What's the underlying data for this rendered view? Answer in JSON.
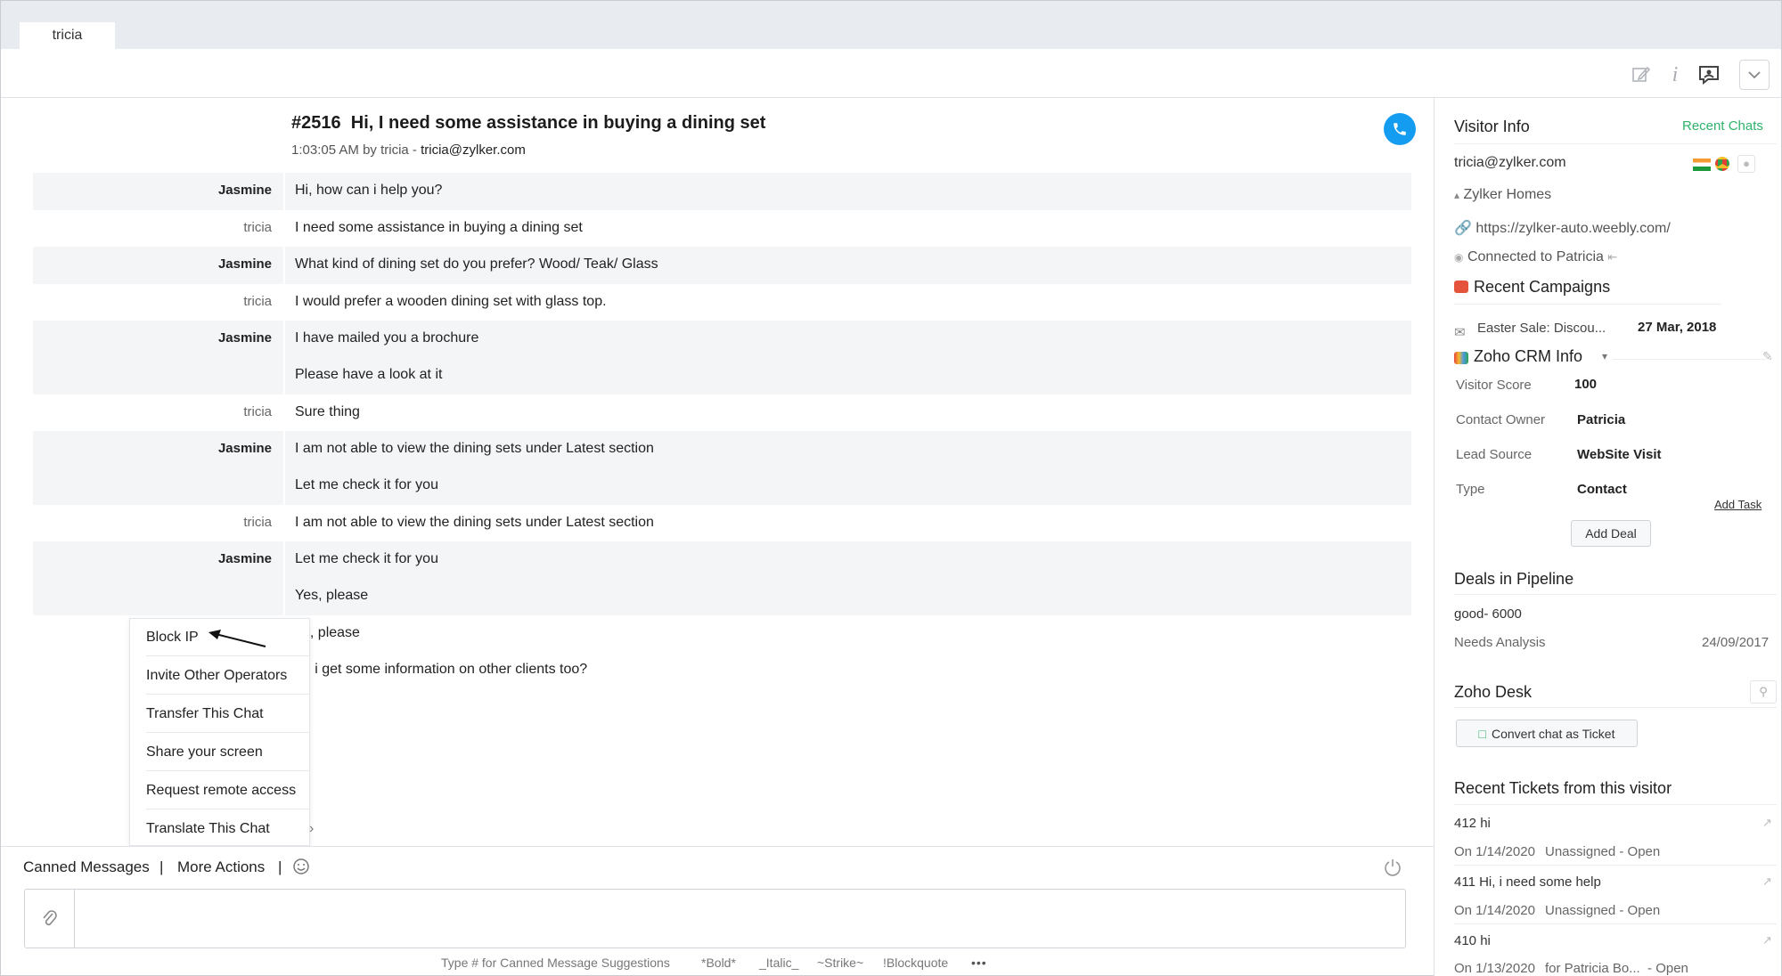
{
  "tabs": [
    "tricia"
  ],
  "chat": {
    "id": "#2516",
    "subject": "Hi, I need some assistance in buying a dining set",
    "time": "1:03:05 AM",
    "by_prefix": "by",
    "visitor": "tricia",
    "dash": "-",
    "email": "tricia@zylker.com"
  },
  "messages": [
    {
      "name": "Jasmine",
      "role": "operator",
      "lines": [
        "Hi, how can i help you?"
      ]
    },
    {
      "name": "tricia",
      "role": "visitor",
      "lines": [
        "I need some assistance in buying a dining set"
      ]
    },
    {
      "name": "Jasmine",
      "role": "operator",
      "lines": [
        "What kind of dining set do you prefer? Wood/ Teak/ Glass"
      ]
    },
    {
      "name": "tricia",
      "role": "visitor",
      "lines": [
        "I would prefer a wooden dining set with glass top."
      ]
    },
    {
      "name": "Jasmine",
      "role": "operator",
      "lines": [
        "I have mailed you a brochure",
        "Please have a look at it"
      ]
    },
    {
      "name": "tricia",
      "role": "visitor",
      "lines": [
        "Sure thing"
      ]
    },
    {
      "name": "Jasmine",
      "role": "operator",
      "lines": [
        "I am not able to view the dining sets under Latest section",
        "Let me check it for you"
      ]
    },
    {
      "name": "tricia",
      "role": "visitor",
      "lines": [
        "I am not able to view the dining sets under Latest section"
      ]
    },
    {
      "name": "Jasmine",
      "role": "operator",
      "lines": [
        "Let me check it for you",
        "Yes, please"
      ]
    },
    {
      "name": "",
      "role": "visitor",
      "lines": [
        "es, please"
      ]
    },
    {
      "name": "",
      "role": "visitor",
      "lines": [
        "an i get some information on other clients too?"
      ]
    }
  ],
  "more_actions_menu": [
    "Block IP",
    "Invite Other Operators",
    "Transfer This Chat",
    "Share your screen",
    "Request remote access",
    "Translate This Chat"
  ],
  "bottom_bar": {
    "canned": "Canned Messages",
    "sep": "|",
    "more_actions": "More Actions",
    "hints": [
      "Type # for Canned Message Suggestions",
      "*Bold*",
      "_Italic_",
      "~Strike~",
      "!Blockquote",
      "•••"
    ]
  },
  "visitor_info": {
    "title": "Visitor Info",
    "recent_chats": "Recent Chats",
    "email": "tricia@zylker.com",
    "company": "Zylker Homes",
    "url": "https://zylker-auto.weebly.com/",
    "connected": "Connected to Patricia"
  },
  "recent_campaigns": {
    "title": "Recent Campaigns",
    "name": "Easter Sale: Discou...",
    "date": "27 Mar, 2018"
  },
  "crm": {
    "title": "Zoho CRM Info",
    "fields": [
      {
        "label": "Visitor Score",
        "value": "100"
      },
      {
        "label": "Contact Owner",
        "value": "Patricia"
      },
      {
        "label": "Lead Source",
        "value": "WebSite Visit"
      },
      {
        "label": "Type",
        "value": "Contact"
      }
    ],
    "add_task": "Add Task",
    "add_deal": "Add Deal"
  },
  "deals": {
    "title": "Deals in Pipeline",
    "name": "good- 6000",
    "stage": "Needs Analysis",
    "date": "24/09/2017"
  },
  "desk": {
    "title": "Zoho Desk",
    "convert": "Convert chat as Ticket"
  },
  "tickets": {
    "title": "Recent Tickets from this visitor",
    "items": [
      {
        "subject": "412 hi",
        "date": "On 1/14/2020",
        "status": "Unassigned - Open"
      },
      {
        "subject": "411 Hi, i need some help",
        "date": "On 1/14/2020",
        "status": "Unassigned - Open"
      },
      {
        "subject": "410 hi",
        "date": "On 1/13/2020",
        "status": "for Patricia Bo...  - Open"
      }
    ]
  },
  "colors": {
    "accent": "#149cf0",
    "recent_chats": "#2fb36c"
  },
  "icons": [
    "edit-icon",
    "info-icon",
    "chat-bubble-icon",
    "chevron-down-icon",
    "phone-icon",
    "smiley-icon",
    "power-icon",
    "paperclip-icon"
  ]
}
